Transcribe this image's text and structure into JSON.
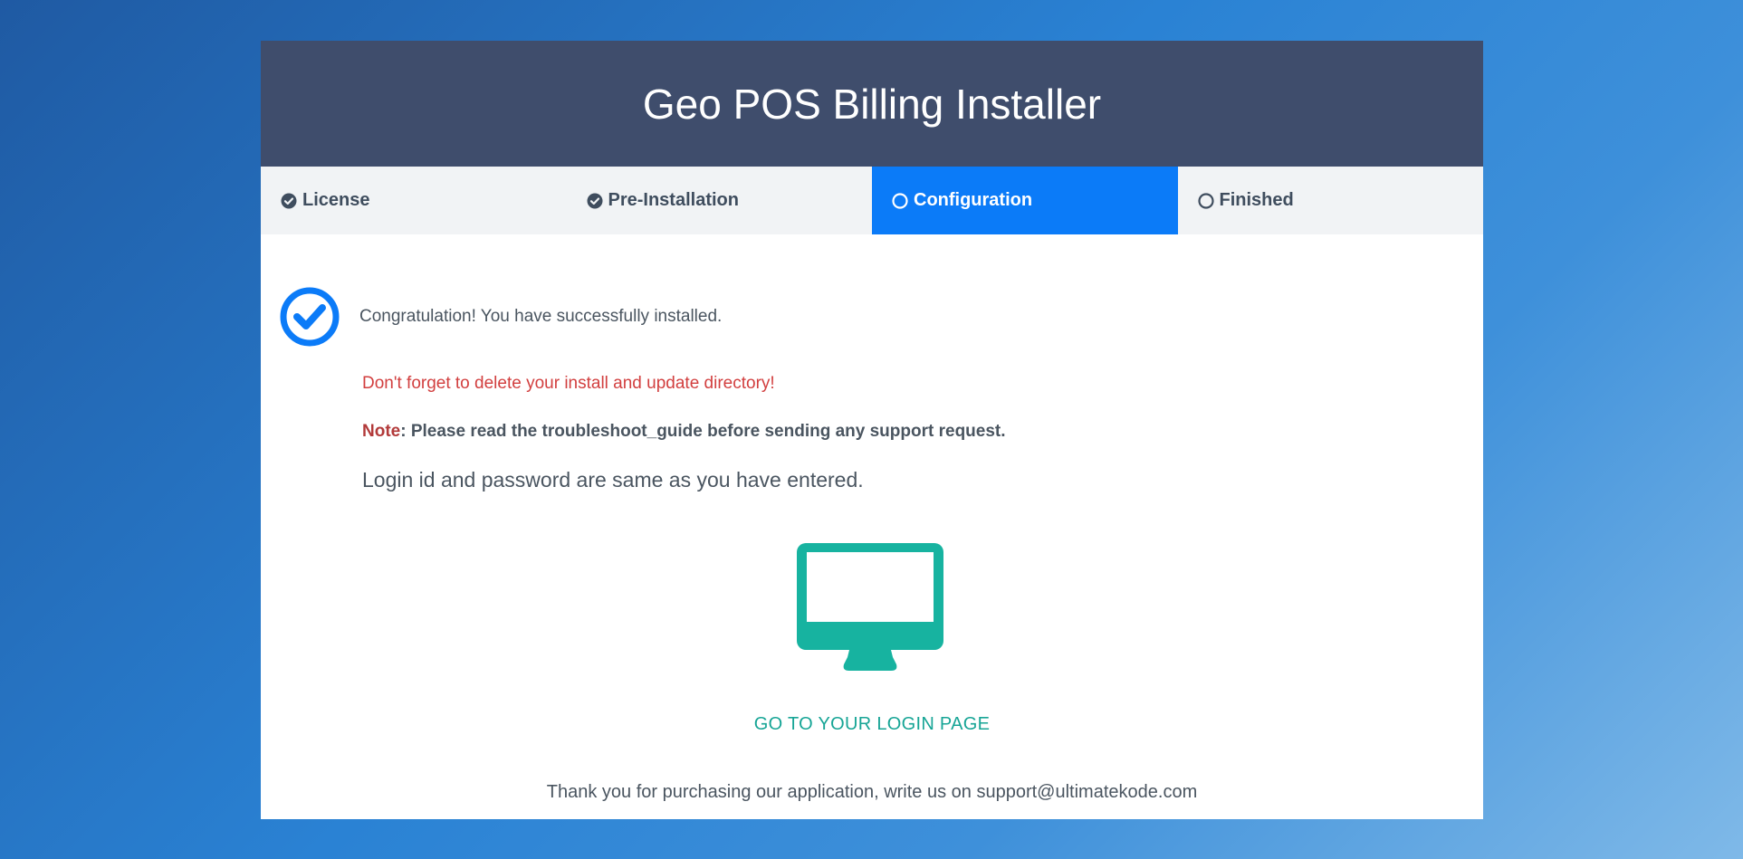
{
  "header": {
    "title": "Geo POS Billing Installer"
  },
  "steps": [
    {
      "label": "License",
      "state": "done",
      "icon": "check-circle-icon"
    },
    {
      "label": "Pre-Installation",
      "state": "done",
      "icon": "check-circle-icon"
    },
    {
      "label": "Configuration",
      "state": "active",
      "icon": "circle-outline-icon"
    },
    {
      "label": "Finished",
      "state": "pending",
      "icon": "circle-outline-icon"
    }
  ],
  "content": {
    "success_message": "Congratulation! You have successfully installed.",
    "warning": "Don't forget to delete your install and update directory!",
    "note_label": "Note",
    "note_text": ": Please read the troubleshoot_guide before sending any support request.",
    "login_info": "Login id and password are same as you have entered.",
    "login_link": "GO TO YOUR LOGIN PAGE",
    "footer": "Thank you for purchasing our application, write us on support@ultimatekode.com"
  },
  "colors": {
    "header_bg": "#3f4d6c",
    "active_step": "#0b7bf8",
    "success_icon": "#0b7bf8",
    "monitor_icon": "#17b3a0",
    "warning_text": "#d23f3f",
    "link_text": "#17a596"
  }
}
